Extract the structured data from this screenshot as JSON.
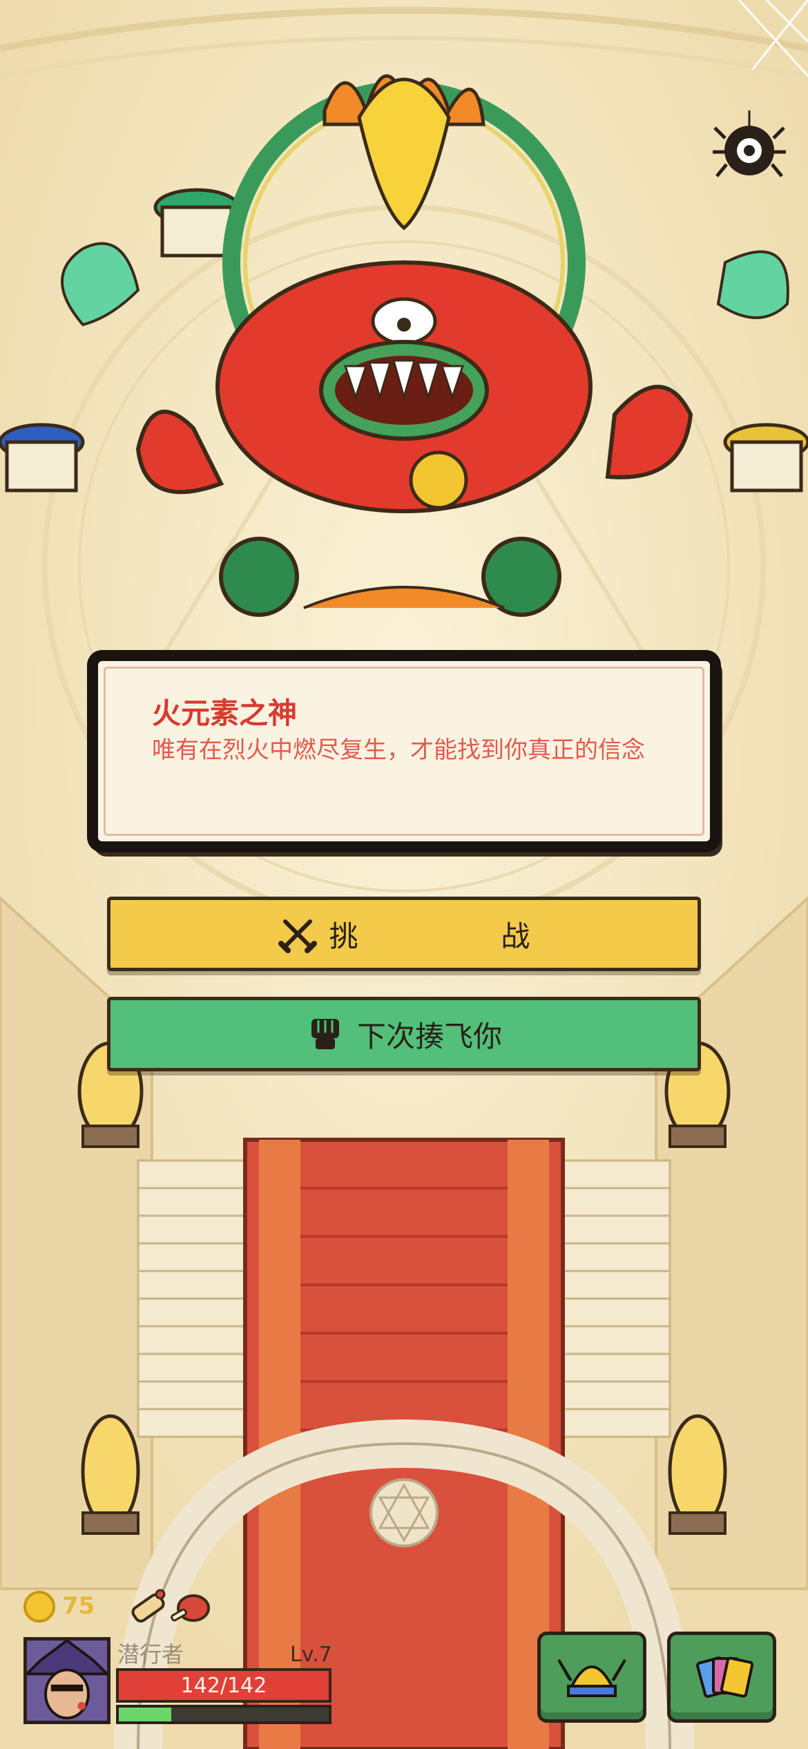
{
  "boss": {
    "name": "火元素之神",
    "quote": "唯有在烈火中燃尽复生，才能找到你真正的信念"
  },
  "actions": {
    "challenge_label_left": "挑",
    "challenge_label_right": "战",
    "challenge_icon": "crossed-swords-icon",
    "next_label": "下次揍飞你",
    "next_icon": "fist-icon"
  },
  "hud": {
    "coins": "75",
    "player_name": "潜行者",
    "level": "Lv.7",
    "hp": "142/142",
    "xp_fraction": 0.25,
    "relics": [
      "scroll-relic-icon",
      "meat-relic-icon"
    ],
    "menu_buttons": [
      "viking-helmet-icon",
      "cards-deck-icon"
    ]
  },
  "colors": {
    "challenge_button": "#f4ca4a",
    "next_button": "#52c07a",
    "boss_title": "#d83a30",
    "hp_bar": "#e04038",
    "xp_bar": "#6bd66a"
  },
  "top_right_icon": "spider-settings-icon"
}
